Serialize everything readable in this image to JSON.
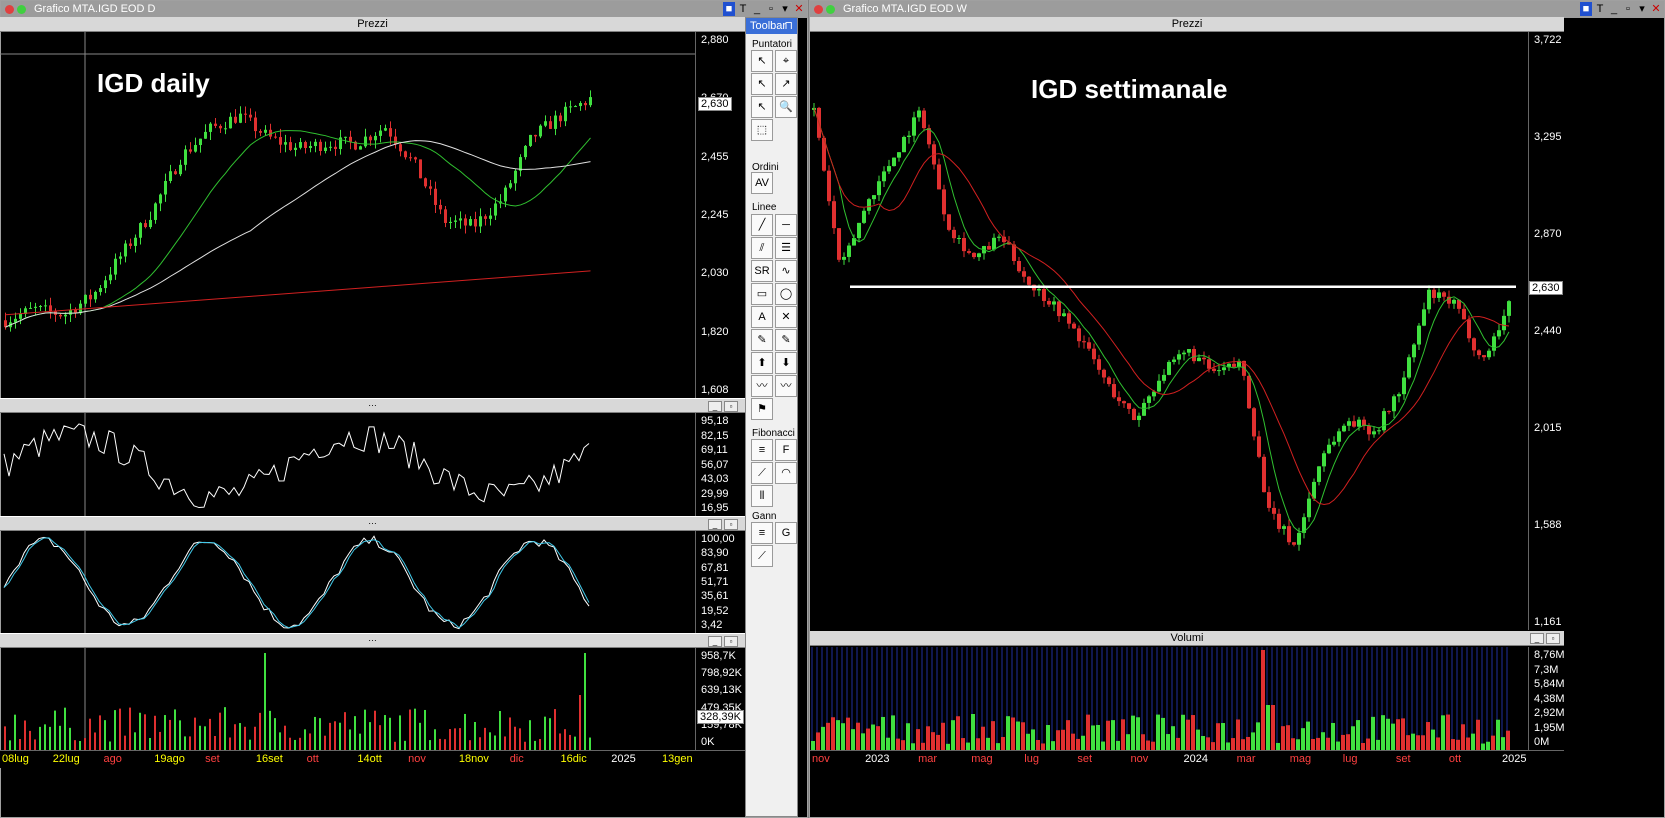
{
  "left_window": {
    "title": "Grafico MTA.IGD EOD D",
    "pane_title": "Prezzi",
    "chart_label": "IGD daily",
    "last_price": "2,630",
    "price_axis": [
      "2,880",
      "2,670",
      "2,455",
      "2,245",
      "2,030",
      "1,820",
      "1,608"
    ],
    "osc1_axis": [
      "95,18",
      "82,15",
      "69,11",
      "56,07",
      "43,03",
      "29,99",
      "16,95"
    ],
    "osc2_axis": [
      "100,00",
      "83,90",
      "67,81",
      "51,71",
      "35,61",
      "19,52",
      "3,42"
    ],
    "vol_axis": [
      "958,7K",
      "798,92K",
      "639,13K",
      "479,35K",
      "159,78K",
      "0K"
    ],
    "vol_last": "328,39K",
    "x_labels": [
      {
        "text": "08lug",
        "color": "#ffff00"
      },
      {
        "text": "22lug",
        "color": "#ffff00"
      },
      {
        "text": "ago",
        "color": "#ff4040"
      },
      {
        "text": "19ago",
        "color": "#ffff00"
      },
      {
        "text": "set",
        "color": "#ff4040"
      },
      {
        "text": "16set",
        "color": "#ffff00"
      },
      {
        "text": "ott",
        "color": "#ff4040"
      },
      {
        "text": "14ott",
        "color": "#ffff00"
      },
      {
        "text": "nov",
        "color": "#ff4040"
      },
      {
        "text": "18nov",
        "color": "#ffff00"
      },
      {
        "text": "dic",
        "color": "#ff4040"
      },
      {
        "text": "16dic",
        "color": "#ffff00"
      },
      {
        "text": "2025",
        "color": "#ffffff"
      },
      {
        "text": "13gen",
        "color": "#ffff00"
      }
    ]
  },
  "right_window": {
    "title": "Grafico MTA.IGD EOD W",
    "pane_title": "Prezzi",
    "chart_label": "IGD settimanale",
    "last_price": "2,630",
    "price_axis": [
      "3,722",
      "3,295",
      "2,870",
      "2,440",
      "2,015",
      "1,588",
      "1,161"
    ],
    "vol_title": "Volumi",
    "vol_axis": [
      "8,76M",
      "7,3M",
      "5,84M",
      "4,38M",
      "2,92M",
      "1,95M",
      "0M"
    ],
    "x_labels": [
      {
        "text": "nov",
        "color": "#ff4040"
      },
      {
        "text": "2023",
        "color": "#ffffff"
      },
      {
        "text": "mar",
        "color": "#ff4040"
      },
      {
        "text": "mag",
        "color": "#ff4040"
      },
      {
        "text": "lug",
        "color": "#ff4040"
      },
      {
        "text": "set",
        "color": "#ff4040"
      },
      {
        "text": "nov",
        "color": "#ff4040"
      },
      {
        "text": "2024",
        "color": "#ffffff"
      },
      {
        "text": "mar",
        "color": "#ff4040"
      },
      {
        "text": "mag",
        "color": "#ff4040"
      },
      {
        "text": "lug",
        "color": "#ff4040"
      },
      {
        "text": "set",
        "color": "#ff4040"
      },
      {
        "text": "ott",
        "color": "#ff4040"
      },
      {
        "text": "2025",
        "color": "#ffffff"
      }
    ]
  },
  "toolbar": {
    "title": "Toolbar",
    "sections": [
      "Puntatori",
      "Ordini",
      "Linee",
      "Fibonacci",
      "Gann"
    ]
  },
  "colors": {
    "up": "#40e040",
    "down": "#e03030",
    "ma_green": "#30c030",
    "ma_white": "#e0e0e0",
    "ma_red": "#d02020",
    "cyan": "#40c8e8"
  }
}
